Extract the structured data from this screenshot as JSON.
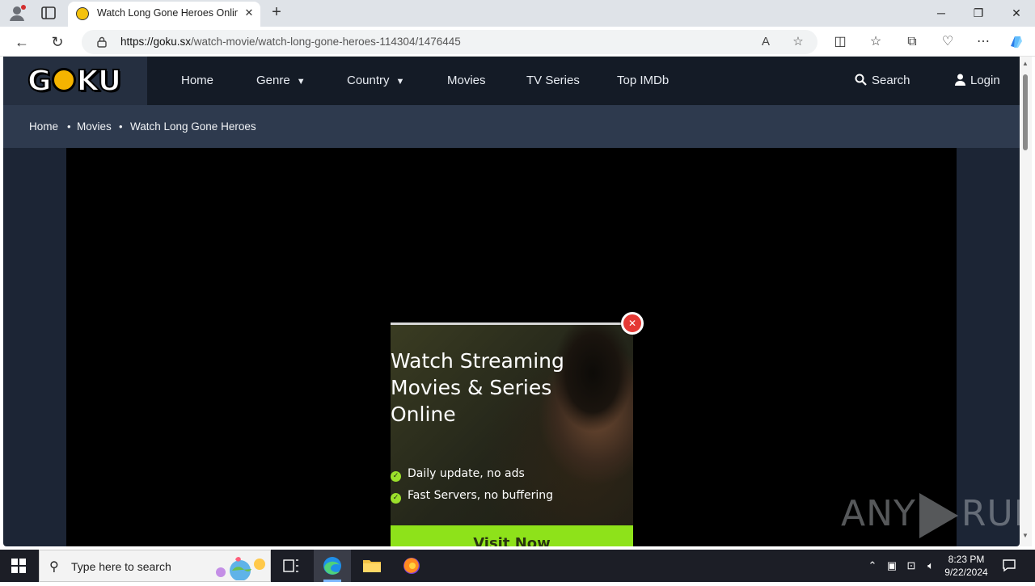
{
  "browser": {
    "tab_title": "Watch Long Gone Heroes Online",
    "tab_close": "✕",
    "new_tab": "+",
    "url_host": "https://goku.sx",
    "url_path": "/watch-movie/watch-long-gone-heroes-114304/1476445"
  },
  "site": {
    "logo": {
      "pre": "G",
      "post": "KU"
    },
    "menu": [
      {
        "label": "Home"
      },
      {
        "label": "Genre"
      },
      {
        "label": "Country"
      },
      {
        "label": "Movies"
      },
      {
        "label": "TV Series"
      },
      {
        "label": "Top IMDb"
      }
    ],
    "search_label": "Search",
    "login_label": "Login",
    "breadcrumb": [
      "Home",
      "Movies",
      "Watch Long Gone Heroes"
    ],
    "breadcrumb_sep": "•"
  },
  "ad": {
    "title": "Watch Streaming Movies & Series Online",
    "features": [
      "Daily update, no ads",
      "Fast Servers, no buffering"
    ],
    "cta": "Visit Now",
    "close": "✕"
  },
  "watermark": {
    "left": "ANY",
    "right": "RUN"
  },
  "taskbar": {
    "search_placeholder": "Type here to search",
    "time": "8:23 PM",
    "date": "9/22/2024"
  },
  "colors": {
    "header_bg": "#141b26",
    "breadcrumb_bg": "#2e3a4e",
    "logo_accent": "#f5b400",
    "ad_cta": "#8ee21a",
    "close_red": "#e53935"
  }
}
